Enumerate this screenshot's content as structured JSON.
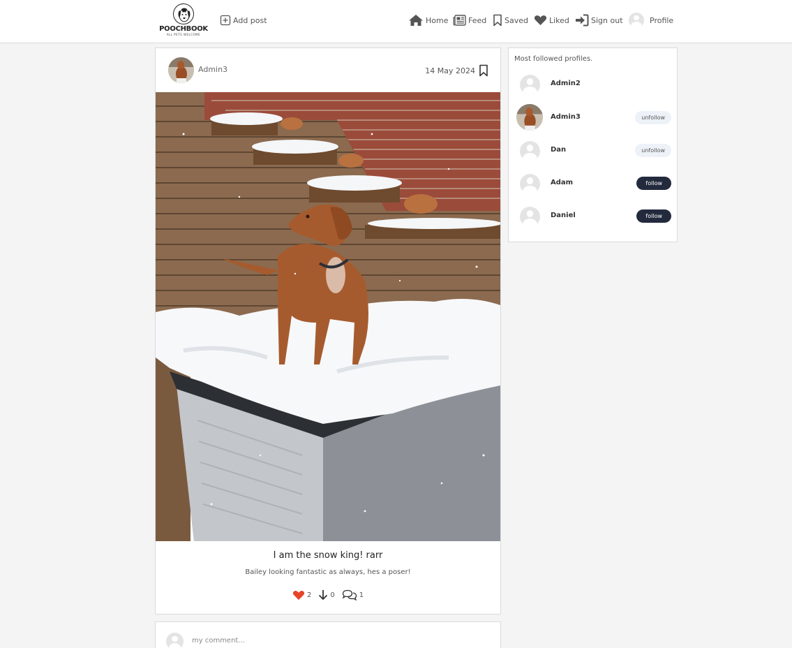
{
  "brand": {
    "name": "POOCHBOOK",
    "tagline": "ALL PETS WELCOME"
  },
  "nav": {
    "add_post": "Add post",
    "home": "Home",
    "feed": "Feed",
    "saved": "Saved",
    "liked": "Liked",
    "sign_out": "Sign out",
    "profile": "Profile"
  },
  "post": {
    "owner": "Admin3",
    "date": "14 May 2024",
    "title": "I am the snow king! rarr",
    "content": "Bailey looking fantastic as always, hes a poser!",
    "likes": "2",
    "downvotes": "0",
    "comments": "1"
  },
  "comment_form": {
    "placeholder": "my comment..."
  },
  "profiles": {
    "title": "Most followed profiles.",
    "items": [
      {
        "name": "Admin2",
        "button": ""
      },
      {
        "name": "Admin3",
        "button": "unfollow"
      },
      {
        "name": "Dan",
        "button": "unfollow"
      },
      {
        "name": "Adam",
        "button": "follow"
      },
      {
        "name": "Daniel",
        "button": "follow"
      }
    ]
  },
  "colors": {
    "like_red": "#e8442a",
    "follow_dark": "#232a3d",
    "unfollow_light": "#edf2f8",
    "page_bg": "#f4f4f4"
  }
}
